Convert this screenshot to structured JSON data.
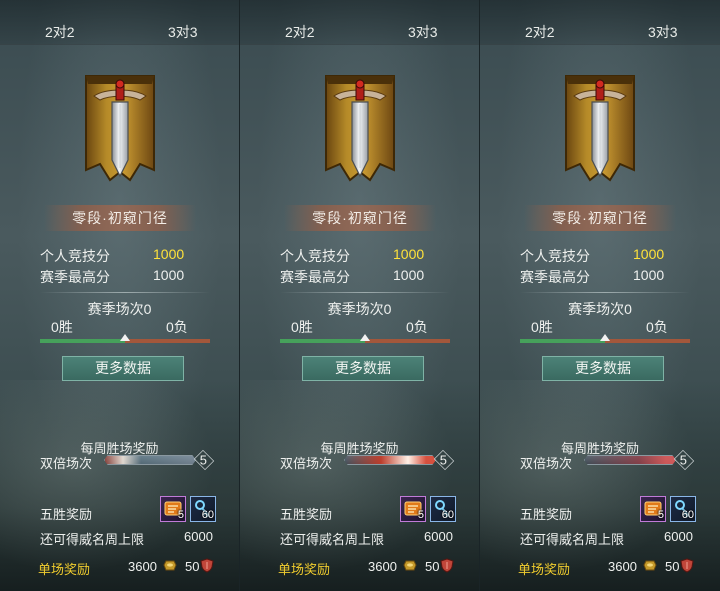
{
  "panels": [
    {
      "tabs": {
        "left": "2对2",
        "right": "3对3"
      },
      "rank_title": "零段·初窥门径",
      "personal_score_label": "个人竞技分",
      "personal_score_value": "1000",
      "season_best_label": "赛季最高分",
      "season_best_value": "1000",
      "season_matches": "赛季场次0",
      "wins": "0胜",
      "losses": "0负",
      "win_ratio": 0.5,
      "more_data": "更多数据",
      "weekly_reward_title": "每周胜场奖励",
      "double_label": "双倍场次",
      "double_count": "5",
      "five_win_label": "五胜奖励",
      "reward_item_1_count": "5",
      "reward_item_2_count": "60",
      "remain_label": "还可得威名周上限",
      "remain_value": "6000",
      "single_label": "单场奖励",
      "single_value_1": "3600",
      "single_value_2": "50",
      "emblem_icon": "sword-banner-icon",
      "double_bar_fill": 1.0
    },
    {
      "tabs": {
        "left": "2对2",
        "right": "3对3"
      },
      "rank_title": "零段·初窥门径",
      "personal_score_label": "个人竞技分",
      "personal_score_value": "1000",
      "season_best_label": "赛季最高分",
      "season_best_value": "1000",
      "season_matches": "赛季场次0",
      "wins": "0胜",
      "losses": "0负",
      "win_ratio": 0.5,
      "more_data": "更多数据",
      "weekly_reward_title": "每周胜场奖励",
      "double_label": "双倍场次",
      "double_count": "5",
      "five_win_label": "五胜奖励",
      "reward_item_1_count": "5",
      "reward_item_2_count": "60",
      "remain_label": "还可得威名周上限",
      "remain_value": "6000",
      "single_label": "单场奖励",
      "single_value_1": "3600",
      "single_value_2": "50",
      "emblem_icon": "sword-banner-icon",
      "double_bar_fill": 1.0
    },
    {
      "tabs": {
        "left": "2对2",
        "right": "3对3"
      },
      "rank_title": "零段·初窥门径",
      "personal_score_label": "个人竞技分",
      "personal_score_value": "1000",
      "season_best_label": "赛季最高分",
      "season_best_value": "1000",
      "season_matches": "赛季场次0",
      "wins": "0胜",
      "losses": "0负",
      "win_ratio": 0.5,
      "more_data": "更多数据",
      "weekly_reward_title": "每周胜场奖励",
      "double_label": "双倍场次",
      "double_count": "5",
      "five_win_label": "五胜奖励",
      "reward_item_1_count": "5",
      "reward_item_2_count": "60",
      "remain_label": "还可得威名周上限",
      "remain_value": "6000",
      "single_label": "单场奖励",
      "single_value_1": "3600",
      "single_value_2": "50",
      "emblem_icon": "sword-banner-icon",
      "double_bar_fill": 1.0
    }
  ],
  "colors": {
    "score_gold": "#ffe23a",
    "single_reward_label": "#f0cc2e",
    "win_bar": "#46a15b",
    "loss_bar": "#a3573b",
    "button": "#3f7066"
  },
  "double_bar_styles": [
    "linear-gradient(90deg, rgba(200,60,40,0.5), rgba(240,230,220,0.9) 20%, rgba(120,160,180,0.4) 40%, rgba(160,180,200,0.5) 100%)",
    "linear-gradient(90deg, rgba(80,100,120,0.3), rgba(200,60,40,0.9) 40%, rgba(255,240,230,1) 70%, rgba(230,80,60,0.9) 90%)",
    "linear-gradient(90deg, rgba(80,100,120,0.2), rgba(160,60,70,0.7) 60%, rgba(220,90,90,0.9) 90%)"
  ]
}
